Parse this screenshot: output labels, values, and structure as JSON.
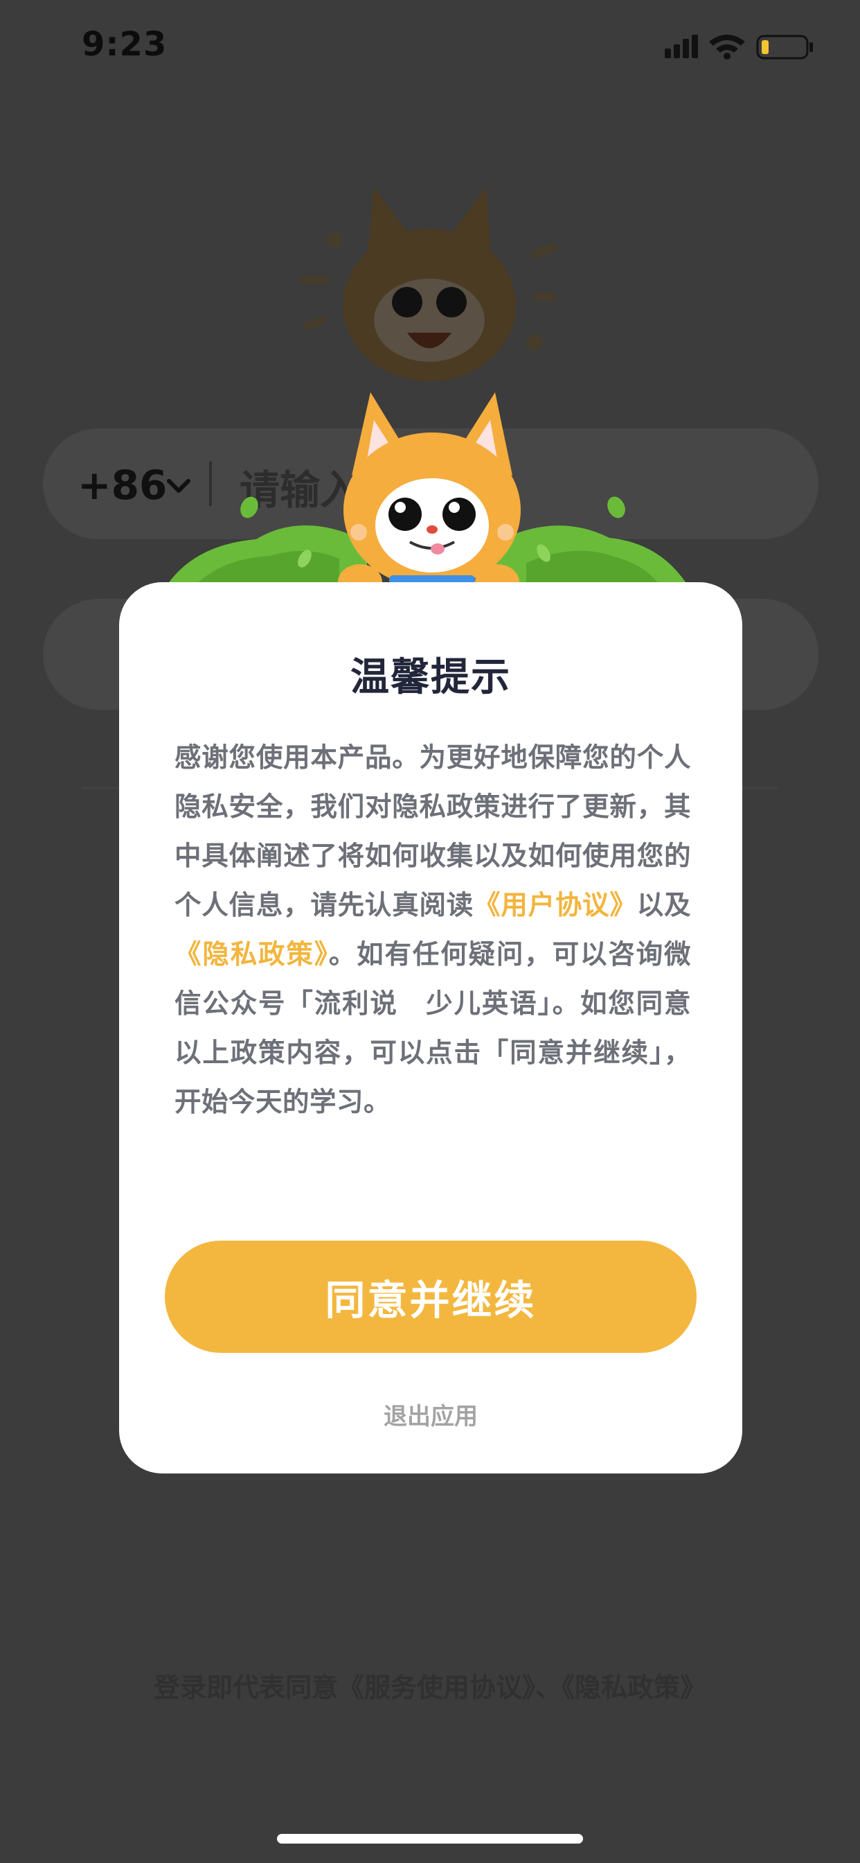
{
  "status_bar": {
    "time": "9:23",
    "battery_color": "#f5c431"
  },
  "login": {
    "country_code": "+86",
    "phone_placeholder": "请输入",
    "agreement": "登录即代表同意《服务使用协议》、《隐私政策》"
  },
  "modal": {
    "title": "温馨提示",
    "body_1": "感谢您使用本产品。为更好地保障您的个人隐私安全，我们对隐私政策进行了更新，其中具体阐述了将如何收集以及如何使用您的个人信息，请先认真阅读",
    "user_agreement_link": "《用户协议》",
    "and_text": "以及",
    "privacy_policy_link": "《隐私政策》",
    "body_2": "。如有任何疑问，可以咨询微信公众号「流利说　少儿英语」。如您同意以上政策内容，可以点击「同意并继续」，开始今天的学习。",
    "agree_button": "同意并继续",
    "exit_button": "退出应用"
  },
  "colors": {
    "accent": "#f3b73f",
    "overlay": "#3c3c3c",
    "title": "#22263a",
    "body": "#6d7078",
    "bush_green": "#6abb3a"
  }
}
